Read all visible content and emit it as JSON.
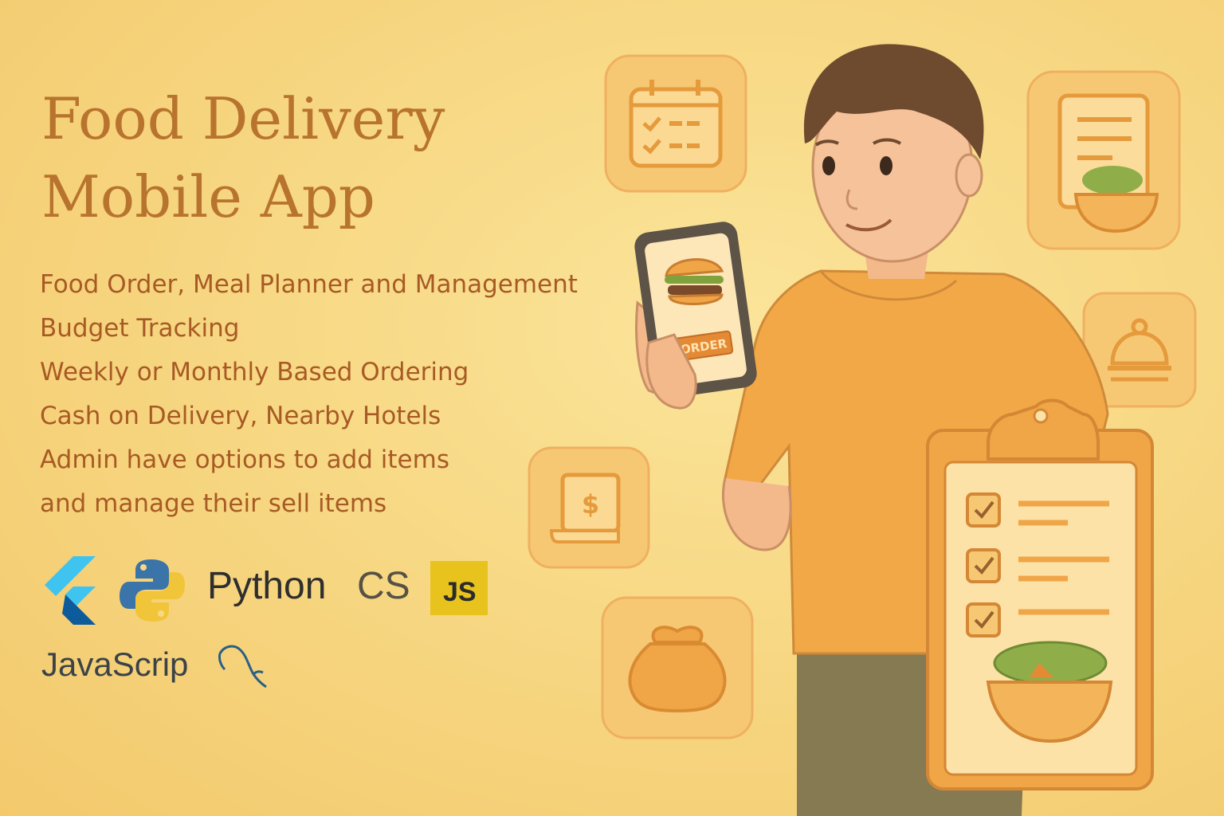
{
  "title": {
    "line1": "Food Delivery",
    "line2": "Mobile App"
  },
  "features": [
    "Food Order, Meal Planner and Management",
    "Budget Tracking",
    "Weekly or Monthly Based Ordering",
    "Cash on Delivery, Nearby Hotels",
    "Admin have options to add items",
    "and manage their sell items"
  ],
  "tech": {
    "python_label": "Python",
    "css_fragment": "CS",
    "js_badge": "JS",
    "javascript_label": "JavaScrip",
    "icons": [
      "flutter-icon",
      "python-icon",
      "mysql-dolphin-icon"
    ]
  },
  "phone": {
    "button_label": "ORDER"
  },
  "decor_icons": [
    "calendar-checklist-icon",
    "menu-salad-icon",
    "cloche-icon",
    "bill-dollar-icon",
    "money-bag-icon",
    "clipboard-checklist-icon"
  ],
  "colors": {
    "background": "#f7d884",
    "title": "#b8742e",
    "feature_text": "#a85a25",
    "accent_orange": "#f0a546",
    "icon_stroke": "#e59a3c"
  }
}
